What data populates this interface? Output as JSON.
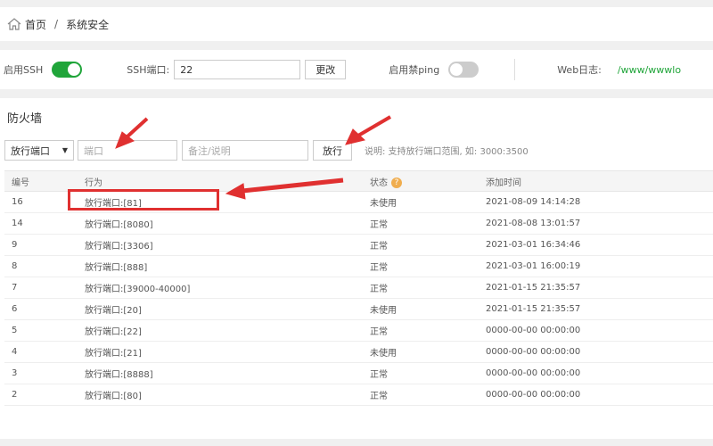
{
  "breadcrumb": {
    "home": "首页",
    "separator": "/",
    "current": "系统安全"
  },
  "ssh": {
    "enable_label": "启用SSH",
    "port_label": "SSH端口:",
    "port_value": "22",
    "change_button": "更改",
    "ping_label": "启用禁ping",
    "weblog_label": "Web日志:",
    "weblog_path": "/www/wwwlo"
  },
  "firewall": {
    "title": "防火墙",
    "select_value": "放行端口",
    "port_placeholder": "端口",
    "note_placeholder": "备注/说明",
    "allow_button": "放行",
    "hint": "说明: 支持放行端口范围, 如: 3000:3500",
    "columns": {
      "id": "编号",
      "action": "行为",
      "status": "状态",
      "added": "添加时间"
    },
    "rows": [
      {
        "id": "16",
        "action": "放行端口:[81]",
        "status": "未使用",
        "time": "2021-08-09 14:14:28"
      },
      {
        "id": "14",
        "action": "放行端口:[8080]",
        "status": "正常",
        "time": "2021-08-08 13:01:57"
      },
      {
        "id": "9",
        "action": "放行端口:[3306]",
        "status": "正常",
        "time": "2021-03-01 16:34:46"
      },
      {
        "id": "8",
        "action": "放行端口:[888]",
        "status": "正常",
        "time": "2021-03-01 16:00:19"
      },
      {
        "id": "7",
        "action": "放行端口:[39000-40000]",
        "status": "正常",
        "time": "2021-01-15 21:35:57"
      },
      {
        "id": "6",
        "action": "放行端口:[20]",
        "status": "未使用",
        "time": "2021-01-15 21:35:57"
      },
      {
        "id": "5",
        "action": "放行端口:[22]",
        "status": "正常",
        "time": "0000-00-00 00:00:00"
      },
      {
        "id": "4",
        "action": "放行端口:[21]",
        "status": "未使用",
        "time": "0000-00-00 00:00:00"
      },
      {
        "id": "3",
        "action": "放行端口:[8888]",
        "status": "正常",
        "time": "0000-00-00 00:00:00"
      },
      {
        "id": "2",
        "action": "放行端口:[80]",
        "status": "正常",
        "time": "0000-00-00 00:00:00"
      }
    ]
  },
  "colors": {
    "accent": "#20a53a",
    "annotation": "#e03030",
    "help": "#f0ad4e"
  }
}
